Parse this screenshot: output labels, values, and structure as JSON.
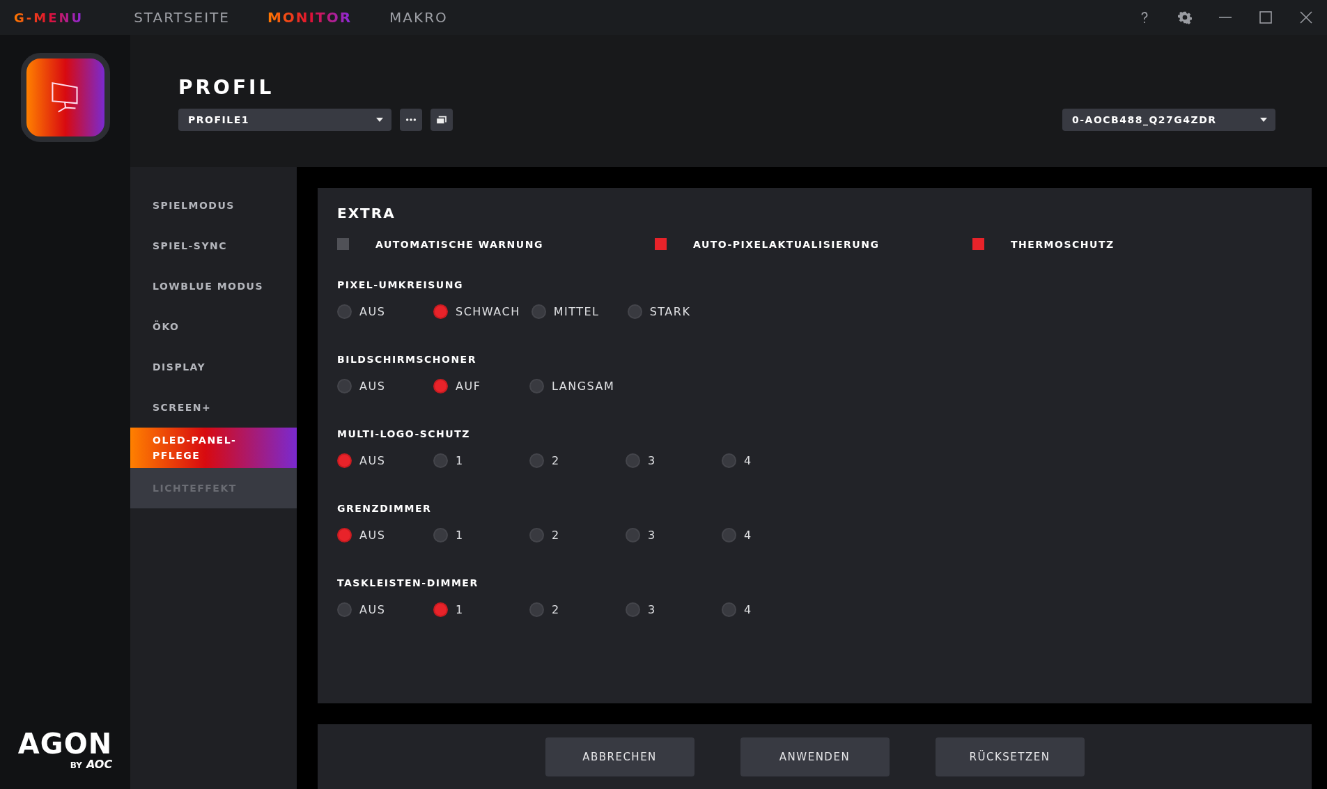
{
  "titlebar": {
    "brand": "G-MENU",
    "tabs": [
      {
        "label": "STARTSEITE",
        "selected": false
      },
      {
        "label": "MONITOR",
        "selected": true
      },
      {
        "label": "MAKRO",
        "selected": false
      }
    ]
  },
  "header": {
    "title": "PROFIL",
    "profile_dropdown": {
      "value": "PROFILE1"
    },
    "monitor_dropdown": {
      "value": "0-AOCB488_Q27G4ZDR"
    }
  },
  "sidebar": {
    "items": [
      {
        "label": "SPIELMODUS",
        "selected": false,
        "disabled": false
      },
      {
        "label": "SPIEL-SYNC",
        "selected": false,
        "disabled": false
      },
      {
        "label": "LOWBLUE MODUS",
        "selected": false,
        "disabled": false
      },
      {
        "label": "ÖKO",
        "selected": false,
        "disabled": false
      },
      {
        "label": "DISPLAY",
        "selected": false,
        "disabled": false
      },
      {
        "label": "SCREEN+",
        "selected": false,
        "disabled": false
      },
      {
        "label": "OLED-PANEL-PFLEGE",
        "selected": true,
        "disabled": false
      },
      {
        "label": "LICHTEFFEKT",
        "selected": false,
        "disabled": true
      }
    ]
  },
  "panel": {
    "title": "EXTRA",
    "checkboxes": [
      {
        "label": "AUTOMATISCHE WARNUNG",
        "checked": false
      },
      {
        "label": "AUTO-PIXELAKTUALISIERUNG",
        "checked": true
      },
      {
        "label": "THERMOSCHUTZ",
        "checked": true
      }
    ],
    "groups": [
      {
        "title": "PIXEL-UMKREISUNG",
        "options": [
          {
            "label": "AUS",
            "selected": false
          },
          {
            "label": "SCHWACH",
            "selected": true
          },
          {
            "label": "MITTEL",
            "selected": false
          },
          {
            "label": "STARK",
            "selected": false
          }
        ]
      },
      {
        "title": "BILDSCHIRMSCHONER",
        "options": [
          {
            "label": "AUS",
            "selected": false
          },
          {
            "label": "AUF",
            "selected": true
          },
          {
            "label": "LANGSAM",
            "selected": false
          }
        ]
      },
      {
        "title": "MULTI-LOGO-SCHUTZ",
        "options": [
          {
            "label": "AUS",
            "selected": true
          },
          {
            "label": "1",
            "selected": false
          },
          {
            "label": "2",
            "selected": false
          },
          {
            "label": "3",
            "selected": false
          },
          {
            "label": "4",
            "selected": false
          }
        ]
      },
      {
        "title": "GRENZDIMMER",
        "options": [
          {
            "label": "AUS",
            "selected": true
          },
          {
            "label": "1",
            "selected": false
          },
          {
            "label": "2",
            "selected": false
          },
          {
            "label": "3",
            "selected": false
          },
          {
            "label": "4",
            "selected": false
          }
        ]
      },
      {
        "title": "TASKLEISTEN-DIMMER",
        "options": [
          {
            "label": "AUS",
            "selected": false
          },
          {
            "label": "1",
            "selected": true
          },
          {
            "label": "2",
            "selected": false
          },
          {
            "label": "3",
            "selected": false
          },
          {
            "label": "4",
            "selected": false
          }
        ]
      }
    ]
  },
  "buttons": [
    "ABBRECHEN",
    "ANWENDEN",
    "RÜCKSETZEN"
  ],
  "logo": {
    "brand": "AGON",
    "by": "BY",
    "maker": "AOC"
  }
}
